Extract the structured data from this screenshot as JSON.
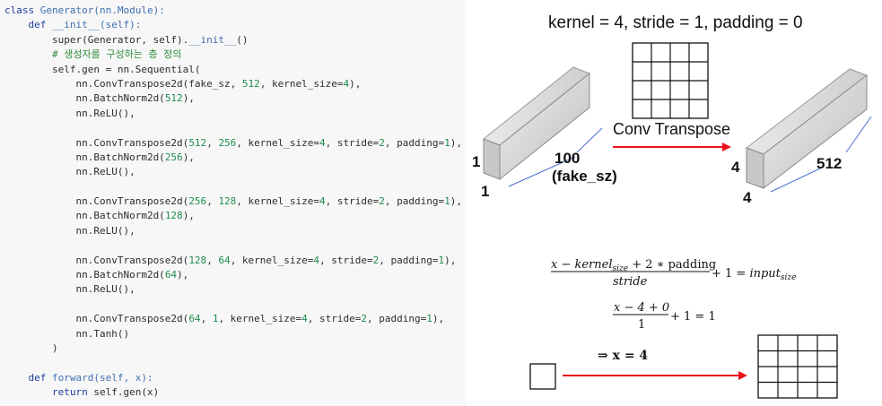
{
  "code": {
    "lines": [
      [
        {
          "t": "class ",
          "c": "kw"
        },
        {
          "t": "Generator",
          "c": "fn"
        },
        {
          "t": "(nn.Module):",
          "c": "fn"
        }
      ],
      [
        {
          "t": "    "
        },
        {
          "t": "def ",
          "c": "kw"
        },
        {
          "t": "__init__",
          "c": "fn"
        },
        {
          "t": "(self):",
          "c": "fn"
        }
      ],
      [
        {
          "t": "        super(Generator, self).",
          "c": ""
        },
        {
          "t": "__init__",
          "c": "fn"
        },
        {
          "t": "()",
          "c": ""
        }
      ],
      [
        {
          "t": "        "
        },
        {
          "t": "# 생성자를 구성하는 층 정의",
          "c": "cm"
        }
      ],
      [
        {
          "t": "        self.gen = nn.Sequential(",
          "c": ""
        }
      ],
      [
        {
          "t": "            nn.ConvTranspose2d(fake_sz, ",
          "c": ""
        },
        {
          "t": "512",
          "c": "num"
        },
        {
          "t": ", kernel_size=",
          "c": ""
        },
        {
          "t": "4",
          "c": "num"
        },
        {
          "t": "),",
          "c": ""
        }
      ],
      [
        {
          "t": "            nn.BatchNorm2d(",
          "c": ""
        },
        {
          "t": "512",
          "c": "num"
        },
        {
          "t": "),",
          "c": ""
        }
      ],
      [
        {
          "t": "            nn.ReLU(),",
          "c": ""
        }
      ],
      [],
      [
        {
          "t": "            nn.ConvTranspose2d(",
          "c": ""
        },
        {
          "t": "512",
          "c": "num"
        },
        {
          "t": ", ",
          "c": ""
        },
        {
          "t": "256",
          "c": "num"
        },
        {
          "t": ", kernel_size=",
          "c": ""
        },
        {
          "t": "4",
          "c": "num"
        },
        {
          "t": ", stride=",
          "c": ""
        },
        {
          "t": "2",
          "c": "num"
        },
        {
          "t": ", padding=",
          "c": ""
        },
        {
          "t": "1",
          "c": "num"
        },
        {
          "t": "),",
          "c": ""
        }
      ],
      [
        {
          "t": "            nn.BatchNorm2d(",
          "c": ""
        },
        {
          "t": "256",
          "c": "num"
        },
        {
          "t": "),",
          "c": ""
        }
      ],
      [
        {
          "t": "            nn.ReLU(),",
          "c": ""
        }
      ],
      [],
      [
        {
          "t": "            nn.ConvTranspose2d(",
          "c": ""
        },
        {
          "t": "256",
          "c": "num"
        },
        {
          "t": ", ",
          "c": ""
        },
        {
          "t": "128",
          "c": "num"
        },
        {
          "t": ", kernel_size=",
          "c": ""
        },
        {
          "t": "4",
          "c": "num"
        },
        {
          "t": ", stride=",
          "c": ""
        },
        {
          "t": "2",
          "c": "num"
        },
        {
          "t": ", padding=",
          "c": ""
        },
        {
          "t": "1",
          "c": "num"
        },
        {
          "t": "),",
          "c": ""
        }
      ],
      [
        {
          "t": "            nn.BatchNorm2d(",
          "c": ""
        },
        {
          "t": "128",
          "c": "num"
        },
        {
          "t": "),",
          "c": ""
        }
      ],
      [
        {
          "t": "            nn.ReLU(),",
          "c": ""
        }
      ],
      [],
      [
        {
          "t": "            nn.ConvTranspose2d(",
          "c": ""
        },
        {
          "t": "128",
          "c": "num"
        },
        {
          "t": ", ",
          "c": ""
        },
        {
          "t": "64",
          "c": "num"
        },
        {
          "t": ", kernel_size=",
          "c": ""
        },
        {
          "t": "4",
          "c": "num"
        },
        {
          "t": ", stride=",
          "c": ""
        },
        {
          "t": "2",
          "c": "num"
        },
        {
          "t": ", padding=",
          "c": ""
        },
        {
          "t": "1",
          "c": "num"
        },
        {
          "t": "),",
          "c": ""
        }
      ],
      [
        {
          "t": "            nn.BatchNorm2d(",
          "c": ""
        },
        {
          "t": "64",
          "c": "num"
        },
        {
          "t": "),",
          "c": ""
        }
      ],
      [
        {
          "t": "            nn.ReLU(),",
          "c": ""
        }
      ],
      [],
      [
        {
          "t": "            nn.ConvTranspose2d(",
          "c": ""
        },
        {
          "t": "64",
          "c": "num"
        },
        {
          "t": ", ",
          "c": ""
        },
        {
          "t": "1",
          "c": "num"
        },
        {
          "t": ", kernel_size=",
          "c": ""
        },
        {
          "t": "4",
          "c": "num"
        },
        {
          "t": ", stride=",
          "c": ""
        },
        {
          "t": "2",
          "c": "num"
        },
        {
          "t": ", padding=",
          "c": ""
        },
        {
          "t": "1",
          "c": "num"
        },
        {
          "t": "),",
          "c": ""
        }
      ],
      [
        {
          "t": "            nn.Tanh()",
          "c": ""
        }
      ],
      [
        {
          "t": "        )",
          "c": ""
        }
      ],
      [],
      [
        {
          "t": "    "
        },
        {
          "t": "def ",
          "c": "kw"
        },
        {
          "t": "forward",
          "c": "fn"
        },
        {
          "t": "(self, x):",
          "c": "fn"
        }
      ],
      [
        {
          "t": "        "
        },
        {
          "t": "return ",
          "c": "kw"
        },
        {
          "t": "self.gen(x)",
          "c": ""
        }
      ]
    ]
  },
  "diagram": {
    "title": "kernel = 4, stride = 1, padding = 0",
    "arrow_label": "Conv Transpose",
    "input_block": {
      "height_label": "1",
      "width_label": "1",
      "depth_label": "100",
      "depth_sublabel": "(fake_sz)"
    },
    "output_block": {
      "height_label": "4",
      "width_label": "4",
      "depth_label": "512"
    },
    "formula": {
      "num_x": "x − kernel",
      "num_sub": "size",
      "num_rest": " + 2 ∗ padding",
      "den": "stride",
      "rhs": " + 1 = ",
      "rhs_var": "input",
      "rhs_sub": "size",
      "sub_num": "x − 4 + 0",
      "sub_den": "1",
      "sub_rhs": " + 1 = 1",
      "result": "⇒ x = 4"
    },
    "colors": {
      "arrow": "#e8161b",
      "grid": "#111111",
      "block_edge": "#4a6fd0"
    }
  }
}
